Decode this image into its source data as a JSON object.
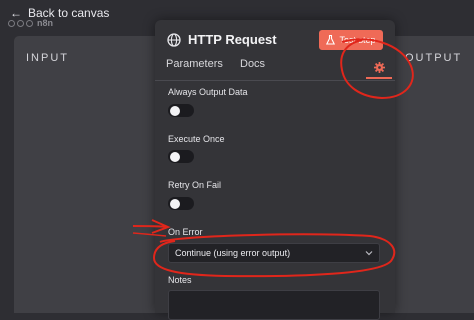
{
  "topbar": {
    "back_label": "Back to canvas",
    "logo_text": "n8n"
  },
  "input_panel": {
    "label": "INPUT"
  },
  "output_panel": {
    "label": "OUTPUT"
  },
  "node": {
    "title": "HTTP Request",
    "test_button": "Test step"
  },
  "tabs": {
    "parameters": "Parameters",
    "docs": "Docs"
  },
  "settings": {
    "always_output": {
      "label": "Always Output Data",
      "enabled": false
    },
    "execute_once": {
      "label": "Execute Once",
      "enabled": false
    },
    "retry_on_fail": {
      "label": "Retry On Fail",
      "enabled": false
    },
    "on_error": {
      "label": "On Error",
      "value": "Continue (using error output)"
    },
    "notes": {
      "label": "Notes",
      "value": ""
    }
  },
  "colors": {
    "accent": "#ef6a57",
    "annotation": "#e0261b",
    "panel": "#404045",
    "modal": "#343438"
  }
}
